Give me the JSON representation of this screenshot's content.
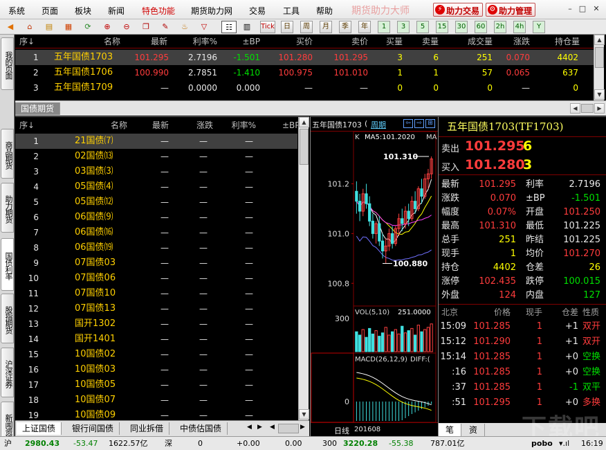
{
  "menu": [
    "系统",
    "页面",
    "板块",
    "新闻",
    "特色功能",
    "期货助力网",
    "交易",
    "工具",
    "帮助"
  ],
  "brand": "期货助力大师",
  "buttons": {
    "trade": "助力交易",
    "manage": "助力管理"
  },
  "window": {
    "minimize": "–",
    "restore": "□",
    "close": "✕"
  },
  "toolbar_periods": [
    "日",
    "周",
    "月",
    "季",
    "年",
    "1",
    "3",
    "5",
    "15",
    "30",
    "60",
    "2h",
    "4h",
    "Y"
  ],
  "toolbar_tick": "Tick",
  "side_tabs": [
    "我的页面",
    "商品期货",
    "助力期货",
    "国债利率",
    "股指期货",
    "沪深证券",
    "新闻资讯"
  ],
  "top_table": {
    "headers": [
      "序↓",
      "名称",
      "最新",
      "利率%",
      "±BP",
      "买价",
      "卖价",
      "买量",
      "卖量",
      "成交量",
      "涨跌",
      "持仓量"
    ],
    "rows": [
      [
        "1",
        "五年国债1703",
        "101.295",
        "2.7196",
        "-1.501",
        "101.280",
        "101.295",
        "3",
        "6",
        "251",
        "0.070",
        "4402"
      ],
      [
        "2",
        "五年国债1706",
        "100.990",
        "2.7851",
        "-1.410",
        "100.975",
        "101.010",
        "1",
        "1",
        "57",
        "0.065",
        "637"
      ],
      [
        "3",
        "五年国债1709",
        "—",
        "0.0000",
        "0.000",
        "—",
        "—",
        "0",
        "0",
        "0",
        "—",
        "0"
      ]
    ],
    "tab": "国债期货"
  },
  "bond_table": {
    "headers": [
      "序↓",
      "名称",
      "最新",
      "涨跌",
      "利率%",
      "±BP"
    ],
    "rows": [
      [
        "1",
        "21国债⑺"
      ],
      [
        "2",
        "02国债⒀"
      ],
      [
        "3",
        "03国债⑶"
      ],
      [
        "4",
        "05国债⑷"
      ],
      [
        "5",
        "05国债⑿"
      ],
      [
        "6",
        "06国债⑼"
      ],
      [
        "7",
        "06国债⒃"
      ],
      [
        "8",
        "06国债⒆"
      ],
      [
        "9",
        "07国债03"
      ],
      [
        "10",
        "07国债06"
      ],
      [
        "11",
        "07国债10"
      ],
      [
        "12",
        "07国债13"
      ],
      [
        "13",
        "国开1302"
      ],
      [
        "14",
        "国开1401"
      ],
      [
        "15",
        "10国债02"
      ],
      [
        "16",
        "10国债03"
      ],
      [
        "17",
        "10国债05"
      ],
      [
        "18",
        "10国债07"
      ],
      [
        "19",
        "10国债09"
      ]
    ],
    "dash": "—",
    "tabs": [
      "上证国债",
      "银行间国债",
      "同业拆借",
      "中债估国债"
    ]
  },
  "chart": {
    "title": "五年国债1703",
    "title_suffix": "(",
    "period_btn": "周期",
    "k_label": "K",
    "ma_label": "MA5:101.2020",
    "ma_label2": "MA",
    "high_label": "101.310",
    "low_label": "100.880",
    "y_ticks": [
      "101.2",
      "101.0",
      "100.8"
    ],
    "vol_label": "VOL(5,10)",
    "vol_value": "251.0000",
    "vol_tick": "300",
    "macd_label": "MACD(26,12,9)",
    "macd_label2": "DIFF:(",
    "macd_tick": "0",
    "footer_left": "日线",
    "footer_date": "201608"
  },
  "chart_data": {
    "type": "candlestick",
    "ylim": [
      100.72,
      101.36
    ],
    "candles": [
      [
        101.17,
        101.21,
        101.08,
        101.13
      ],
      [
        101.13,
        101.16,
        101.05,
        101.09
      ],
      [
        101.09,
        101.18,
        101.07,
        101.16
      ],
      [
        101.16,
        101.2,
        101.1,
        101.12
      ],
      [
        101.12,
        101.15,
        101.03,
        101.05
      ],
      [
        101.05,
        101.08,
        100.98,
        101.0
      ],
      [
        101.0,
        101.05,
        100.96,
        101.04
      ],
      [
        101.04,
        101.07,
        100.95,
        100.97
      ],
      [
        100.97,
        101.0,
        100.9,
        100.93
      ],
      [
        100.93,
        100.98,
        100.88,
        100.95
      ],
      [
        100.95,
        101.02,
        100.93,
        101.0
      ],
      [
        101.0,
        101.03,
        100.94,
        100.96
      ],
      [
        100.96,
        101.03,
        100.95,
        101.02
      ],
      [
        101.02,
        101.08,
        100.99,
        101.06
      ],
      [
        101.06,
        101.1,
        101.01,
        101.04
      ],
      [
        101.04,
        101.11,
        101.02,
        101.09
      ],
      [
        101.09,
        101.12,
        101.03,
        101.06
      ],
      [
        101.06,
        101.15,
        101.05,
        101.13
      ],
      [
        101.13,
        101.17,
        101.08,
        101.1
      ],
      [
        101.1,
        101.19,
        101.09,
        101.18
      ],
      [
        101.18,
        101.22,
        101.12,
        101.15
      ],
      [
        101.15,
        101.24,
        101.14,
        101.22
      ],
      [
        101.22,
        101.26,
        101.18,
        101.24
      ],
      [
        101.24,
        101.31,
        101.22,
        101.3
      ]
    ],
    "volume": [
      180,
      150,
      200,
      130,
      210,
      160,
      190,
      140,
      170,
      220,
      150,
      180,
      200,
      160,
      230,
      170,
      190,
      210,
      150,
      240,
      180,
      200,
      220,
      251
    ],
    "macd": [
      -0.05,
      -0.06,
      -0.07,
      -0.075,
      -0.08,
      -0.085,
      -0.08,
      -0.078,
      -0.074,
      -0.07,
      -0.065,
      -0.06,
      -0.055,
      -0.05,
      -0.045,
      -0.04,
      -0.035,
      -0.03,
      -0.026,
      -0.022,
      -0.018,
      -0.014,
      -0.01,
      -0.006
    ]
  },
  "quote": {
    "title": "五年国债1703(TF1703)",
    "sell_label": "卖出",
    "sell_price": "101.295",
    "sell_vol": "6",
    "buy_label": "买入",
    "buy_price": "101.280",
    "buy_vol": "3",
    "stats": [
      [
        "最新",
        "101.295",
        "利率",
        "2.7196"
      ],
      [
        "涨跌",
        "0.070",
        "±BP",
        "-1.501"
      ],
      [
        "幅度",
        "0.07%",
        "开盘",
        "101.250"
      ],
      [
        "最高",
        "101.310",
        "最低",
        "101.225"
      ],
      [
        "总手",
        "251",
        "昨结",
        "101.225"
      ],
      [
        "现手",
        "1",
        "均价",
        "101.270"
      ],
      [
        "持仓",
        "4402",
        "仓差",
        "26"
      ],
      [
        "涨停",
        "102.435",
        "跌停",
        "100.015"
      ],
      [
        "外盘",
        "124",
        "内盘",
        "127"
      ]
    ],
    "ticks_headers": [
      "北京",
      "价格",
      "现手",
      "仓差",
      "性质"
    ],
    "ticks": [
      [
        "15:09",
        "101.285",
        "1",
        "+1",
        "双开"
      ],
      [
        "15:12",
        "101.290",
        "1",
        "+1",
        "双开"
      ],
      [
        "15:14",
        "101.285",
        "1",
        "+0",
        "空换"
      ],
      [
        ":16",
        "101.285",
        "1",
        "+0",
        "空换"
      ],
      [
        ":37",
        "101.285",
        "1",
        "-1",
        "双平"
      ],
      [
        ":51",
        "101.295",
        "1",
        "+0",
        "多换"
      ]
    ],
    "tabs": [
      "笔",
      "资"
    ]
  },
  "status": {
    "sh_label": "沪",
    "sh_index": "2980.43",
    "sh_change": "-53.47",
    "sh_amount": "1622.57亿",
    "sz_label": "深",
    "sz_index": "0",
    "sz_change": "+0.00",
    "sz_amount": "0.00",
    "c3_label": "300",
    "c3_index": "3220.28",
    "c3_change": "-55.38",
    "c3_amount": "787.01亿",
    "logo": "pobo",
    "signal": "▾.ıl",
    "time": "16:19",
    "watermark": "下载吧"
  }
}
